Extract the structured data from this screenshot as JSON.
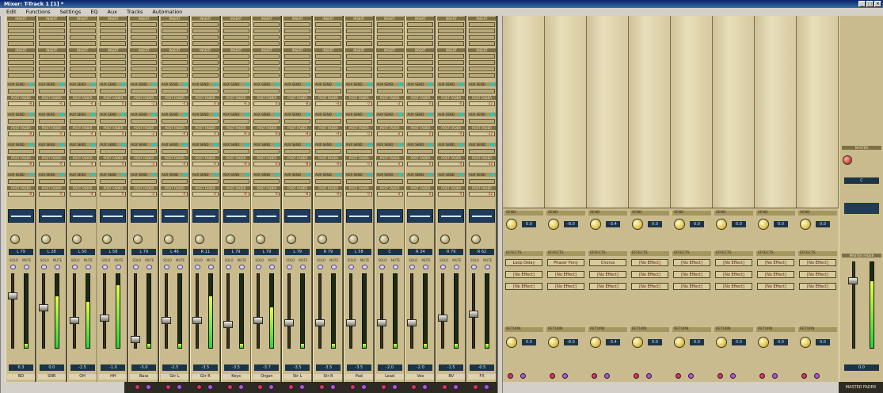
{
  "app": {
    "title": "Mixer: T-Track 1 [1] *"
  },
  "menu": [
    "Edit",
    "Functions",
    "Settings",
    "EQ",
    "Aux",
    "Tracks",
    "Automation"
  ],
  "window_buttons": [
    "_",
    "□",
    "×"
  ],
  "strip_labels": {
    "insert_header": "INSERT",
    "aux_send": "AUX SEND",
    "post_fader": "POST FADER",
    "solo": "SOLO",
    "mute": "MUTE",
    "edit": "EDIT",
    "rec": "REC",
    "auto": "AUTO"
  },
  "channels": [
    {
      "name": "BD",
      "pan": "L 79",
      "volume": "6.3",
      "fader": 0.72,
      "meter": 0.05
    },
    {
      "name": "SNR",
      "pan": "L 28",
      "volume": "0.0",
      "fader": 0.55,
      "meter": 0.7
    },
    {
      "name": "OH",
      "pan": "L 50",
      "volume": "-2.5",
      "fader": 0.36,
      "meter": 0.62
    },
    {
      "name": "HH",
      "pan": "L 58",
      "volume": "-1.0",
      "fader": 0.4,
      "meter": 0.85
    },
    {
      "name": "Bass",
      "pan": "L 79",
      "volume": "-5.0",
      "fader": 0.08,
      "meter": 0.05
    },
    {
      "name": "Gtr L",
      "pan": "L 46",
      "volume": "-2.5",
      "fader": 0.36,
      "meter": 0.05
    },
    {
      "name": "Gtr R",
      "pan": "R 11",
      "volume": "-3.5",
      "fader": 0.36,
      "meter": 0.7
    },
    {
      "name": "Keys",
      "pan": "L 79",
      "volume": "-3.5",
      "fader": 0.3,
      "meter": 0.05
    },
    {
      "name": "Organ",
      "pan": "L 79",
      "volume": "-3.7",
      "fader": 0.36,
      "meter": 0.55
    },
    {
      "name": "Str L",
      "pan": "L 79",
      "volume": "-3.5",
      "fader": 0.33,
      "meter": 0.05
    },
    {
      "name": "Str R",
      "pan": "R 79",
      "volume": "-3.5",
      "fader": 0.33,
      "meter": 0.05
    },
    {
      "name": "Pad",
      "pan": "L 58",
      "volume": "-3.5",
      "fader": 0.33,
      "meter": 0.05
    },
    {
      "name": "Lead",
      "pan": "C",
      "volume": "-2.0",
      "fader": 0.33,
      "meter": 0.05
    },
    {
      "name": "Vox",
      "pan": "R 34",
      "volume": "-2.0",
      "fader": 0.33,
      "meter": 0.05
    },
    {
      "name": "BV",
      "pan": "R 79",
      "volume": "-1.5",
      "fader": 0.4,
      "meter": 0.05
    },
    {
      "name": "FX",
      "pan": "R 62",
      "volume": "-0.5",
      "fader": 0.45,
      "meter": 0.05
    }
  ],
  "send_values": [
    "-8",
    "-6",
    "-4",
    "0",
    "-2",
    "-4",
    "0",
    "-6",
    "0",
    "-8",
    "-4",
    "0",
    "-2",
    "0",
    "-4",
    "-12"
  ],
  "busses": [
    {
      "insert1": "Loop Delay",
      "insert2": "[No Effect]",
      "insert3": "[No Effect]",
      "val": "0.0"
    },
    {
      "insert1": "Phaser Pony",
      "insert2": "[No Effect]",
      "insert3": "[No Effect]",
      "val": "-8.0"
    },
    {
      "insert1": "Chorus",
      "insert2": "[No Effect]",
      "insert3": "[No Effect]",
      "val": "-3.4"
    },
    {
      "insert1": "[No Effect]",
      "insert2": "[No Effect]",
      "insert3": "[No Effect]",
      "val": "0.0"
    },
    {
      "insert1": "[No Effect]",
      "insert2": "[No Effect]",
      "insert3": "[No Effect]",
      "val": "0.0"
    },
    {
      "insert1": "[No Effect]",
      "insert2": "[No Effect]",
      "insert3": "[No Effect]",
      "val": "0.0"
    },
    {
      "insert1": "[No Effect]",
      "insert2": "[No Effect]",
      "insert3": "[No Effect]",
      "val": "0.0"
    },
    {
      "insert1": "[No Effect]",
      "insert2": "[No Effect]",
      "insert3": "[No Effect]",
      "val": "0.0"
    }
  ],
  "bus_labels": {
    "effects": "EFFECTS",
    "send": "SEND",
    "return": "RETURN"
  },
  "master": {
    "label": "MASTER FADER",
    "section": "MASTER",
    "volume": "0.0",
    "fader": 0.8,
    "meter": 0.78,
    "pan": "C"
  }
}
